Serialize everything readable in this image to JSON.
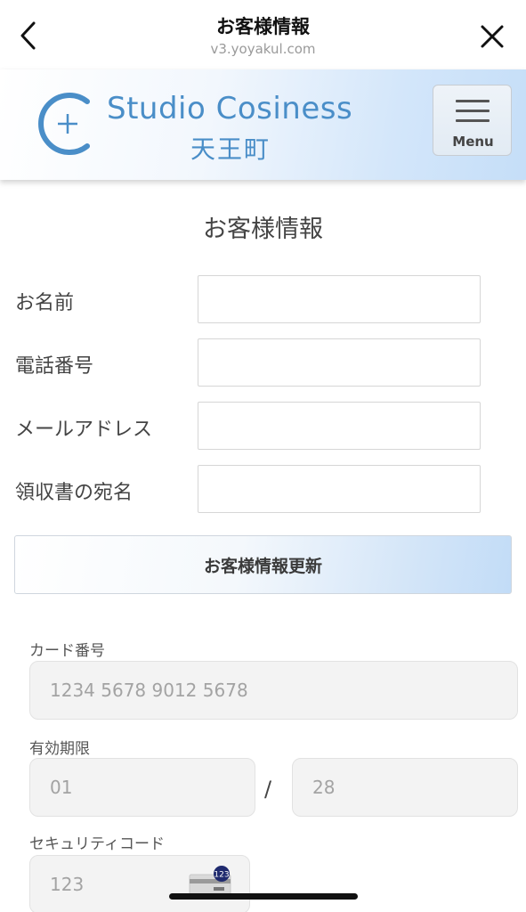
{
  "browser": {
    "title": "お客様情報",
    "url": "v3.yoyakul.com"
  },
  "site": {
    "logo_text": "Studio Cosiness",
    "logo_sub": "天王町",
    "menu_label": "Menu",
    "accent_color": "#4a8ec8"
  },
  "customer_form": {
    "heading": "お客様情報",
    "fields": [
      {
        "label": "お名前",
        "value": ""
      },
      {
        "label": "電話番号",
        "value": ""
      },
      {
        "label": "メールアドレス",
        "value": ""
      },
      {
        "label": "領収書の宛名",
        "value": ""
      }
    ],
    "update_button": "お客様情報更新"
  },
  "card_form": {
    "card_number_label": "カード番号",
    "card_number_placeholder": "1234 5678 9012 5678",
    "expiry_label": "有効期限",
    "expiry_month_placeholder": "01",
    "expiry_separator": "/",
    "expiry_year_placeholder": "28",
    "security_code_label": "セキュリティコード",
    "security_code_placeholder": "123",
    "security_badge": "123"
  },
  "icons": [
    "chevron-left-icon",
    "close-icon",
    "logo-icon",
    "hamburger-icon",
    "card-cvc-icon"
  ]
}
